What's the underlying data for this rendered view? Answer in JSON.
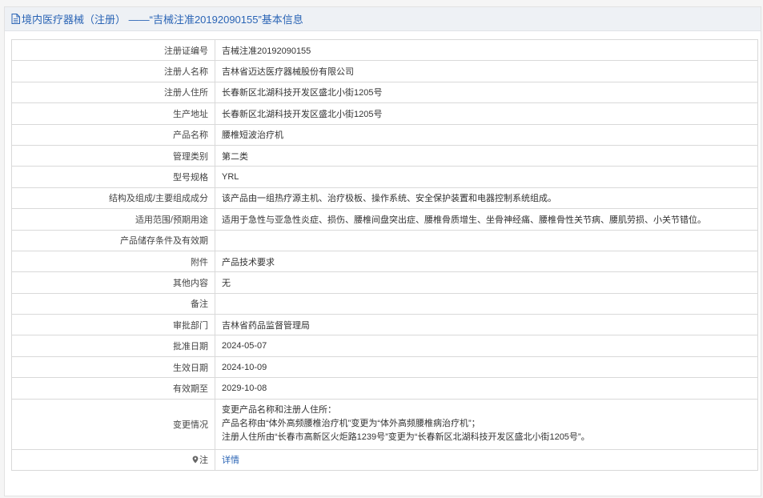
{
  "header": {
    "title": "境内医疗器械（注册） ——“吉械注准20192090155”基本信息"
  },
  "fields": {
    "reg_no": {
      "label": "注册证编号",
      "value": "吉械注准20192090155"
    },
    "registrant": {
      "label": "注册人名称",
      "value": "吉林省迈达医疗器械股份有限公司"
    },
    "registrant_address": {
      "label": "注册人住所",
      "value": "长春新区北湖科技开发区盛北小街1205号"
    },
    "production_address": {
      "label": "生产地址",
      "value": "长春新区北湖科技开发区盛北小街1205号"
    },
    "product_name": {
      "label": "产品名称",
      "value": "腰椎短波治疗机"
    },
    "category": {
      "label": "管理类别",
      "value": "第二类"
    },
    "model": {
      "label": "型号规格",
      "value": "YRL"
    },
    "structure": {
      "label": "结构及组成/主要组成成分",
      "value": "该产品由一组热疗源主机、治疗极板、操作系统、安全保护装置和电器控制系统组成。"
    },
    "scope": {
      "label": "适用范围/预期用途",
      "value": "适用于急性与亚急性炎症、损伤、腰椎间盘突出症、腰椎骨质增生、坐骨神经痛、腰椎骨性关节病、腰肌劳损、小关节错位。"
    },
    "storage": {
      "label": "产品储存条件及有效期",
      "value": ""
    },
    "attachment": {
      "label": "附件",
      "value": "产品技术要求"
    },
    "other": {
      "label": "其他内容",
      "value": "无"
    },
    "remarks": {
      "label": "备注",
      "value": ""
    },
    "approval_dept": {
      "label": "审批部门",
      "value": "吉林省药品监督管理局"
    },
    "approval_date": {
      "label": "批准日期",
      "value": "2024-05-07"
    },
    "effective_date": {
      "label": "生效日期",
      "value": "2024-10-09"
    },
    "expiry_date": {
      "label": "有效期至",
      "value": "2029-10-08"
    },
    "change": {
      "label": "变更情况",
      "lines": [
        "变更产品名称和注册人住所：",
        "产品名称由“体外高频腰椎治疗机”变更为“体外高频腰椎病治疗机”；",
        "注册人住所由“长春市高新区火炬路1239号”变更为“长春新区北湖科技开发区盛北小街1205号”。"
      ]
    },
    "note": {
      "label": "注",
      "link_text": "详情"
    }
  },
  "colors": {
    "accent": "#2a64b5",
    "header_bg": "#eef1f5",
    "border": "#d9d9d9"
  },
  "icons": {
    "title": "document-icon",
    "note": "location-pin-icon"
  }
}
